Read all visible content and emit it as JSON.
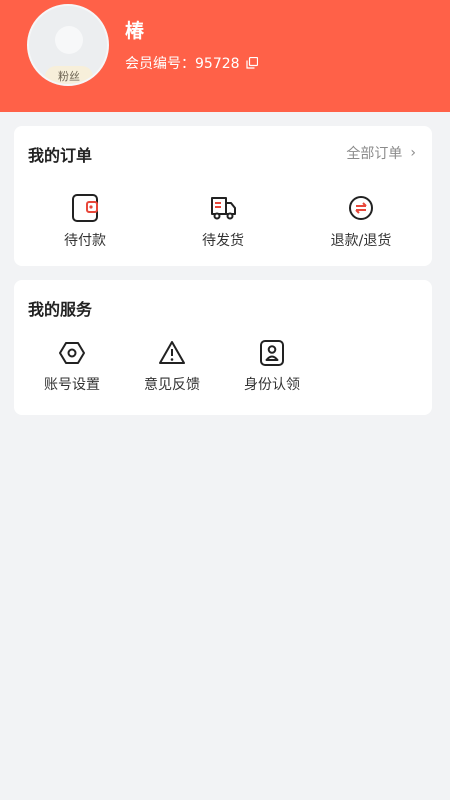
{
  "profile": {
    "name": "椿",
    "badge": "粉丝",
    "member_label": "会员编号：95728"
  },
  "orders": {
    "title": "我的订单",
    "all_label": "全部订单",
    "items": [
      {
        "label": "待付款",
        "icon": "wallet-icon"
      },
      {
        "label": "待发货",
        "icon": "delivery-truck-icon"
      },
      {
        "label": "退款/退货",
        "icon": "refund-icon"
      }
    ]
  },
  "services": {
    "title": "我的服务",
    "items": [
      {
        "label": "账号设置",
        "icon": "settings-icon"
      },
      {
        "label": "意见反馈",
        "icon": "warning-icon"
      },
      {
        "label": "身份认领",
        "icon": "id-badge-icon"
      }
    ]
  },
  "colors": {
    "header": "#ff6148",
    "accent": "#e8473a",
    "background": "#f2f3f5"
  }
}
